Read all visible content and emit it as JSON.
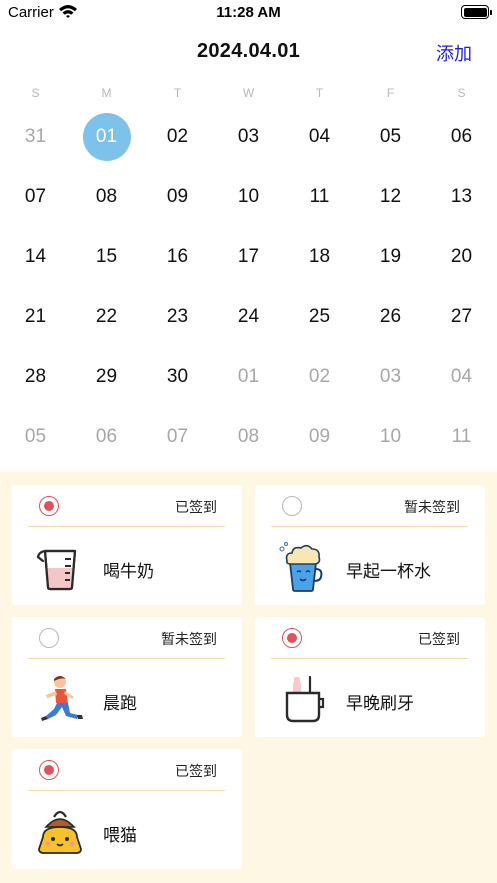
{
  "status_bar": {
    "carrier": "Carrier",
    "time": "11:28 AM"
  },
  "nav": {
    "title": "2024.04.01",
    "add_label": "添加"
  },
  "calendar": {
    "weekdays": [
      "S",
      "M",
      "T",
      "W",
      "T",
      "F",
      "S"
    ],
    "days": [
      {
        "label": "31",
        "state": "other"
      },
      {
        "label": "01",
        "state": "selected"
      },
      {
        "label": "02",
        "state": "current"
      },
      {
        "label": "03",
        "state": "current"
      },
      {
        "label": "04",
        "state": "current"
      },
      {
        "label": "05",
        "state": "current"
      },
      {
        "label": "06",
        "state": "current"
      },
      {
        "label": "07",
        "state": "current"
      },
      {
        "label": "08",
        "state": "current"
      },
      {
        "label": "09",
        "state": "current"
      },
      {
        "label": "10",
        "state": "current"
      },
      {
        "label": "11",
        "state": "current"
      },
      {
        "label": "12",
        "state": "current"
      },
      {
        "label": "13",
        "state": "current"
      },
      {
        "label": "14",
        "state": "current"
      },
      {
        "label": "15",
        "state": "current"
      },
      {
        "label": "16",
        "state": "current"
      },
      {
        "label": "17",
        "state": "current"
      },
      {
        "label": "18",
        "state": "current"
      },
      {
        "label": "19",
        "state": "current"
      },
      {
        "label": "20",
        "state": "current"
      },
      {
        "label": "21",
        "state": "current"
      },
      {
        "label": "22",
        "state": "current"
      },
      {
        "label": "23",
        "state": "current"
      },
      {
        "label": "24",
        "state": "current"
      },
      {
        "label": "25",
        "state": "current"
      },
      {
        "label": "26",
        "state": "current"
      },
      {
        "label": "27",
        "state": "current"
      },
      {
        "label": "28",
        "state": "current"
      },
      {
        "label": "29",
        "state": "current"
      },
      {
        "label": "30",
        "state": "current"
      },
      {
        "label": "01",
        "state": "other"
      },
      {
        "label": "02",
        "state": "other"
      },
      {
        "label": "03",
        "state": "other"
      },
      {
        "label": "04",
        "state": "other"
      },
      {
        "label": "05",
        "state": "other"
      },
      {
        "label": "06",
        "state": "other"
      },
      {
        "label": "07",
        "state": "other"
      },
      {
        "label": "08",
        "state": "other"
      },
      {
        "label": "09",
        "state": "other"
      },
      {
        "label": "10",
        "state": "other"
      },
      {
        "label": "11",
        "state": "other"
      }
    ]
  },
  "habits": [
    {
      "name": "喝牛奶",
      "status": "已签到",
      "checked": true,
      "icon": "milk-cup-icon"
    },
    {
      "name": "早起一杯水",
      "status": "暂未签到",
      "checked": false,
      "icon": "water-cup-icon"
    },
    {
      "name": "晨跑",
      "status": "暂未签到",
      "checked": false,
      "icon": "runner-icon"
    },
    {
      "name": "早晚刷牙",
      "status": "已签到",
      "checked": true,
      "icon": "toothbrush-cup-icon"
    },
    {
      "name": "喂猫",
      "status": "已签到",
      "checked": true,
      "icon": "cat-food-icon"
    }
  ],
  "colors": {
    "accent": "#7cc2eb",
    "add_link": "#1b1fd6",
    "check": "#d9555b",
    "bottom_bg": "#fdf7e3",
    "divider": "#f2dba6"
  }
}
